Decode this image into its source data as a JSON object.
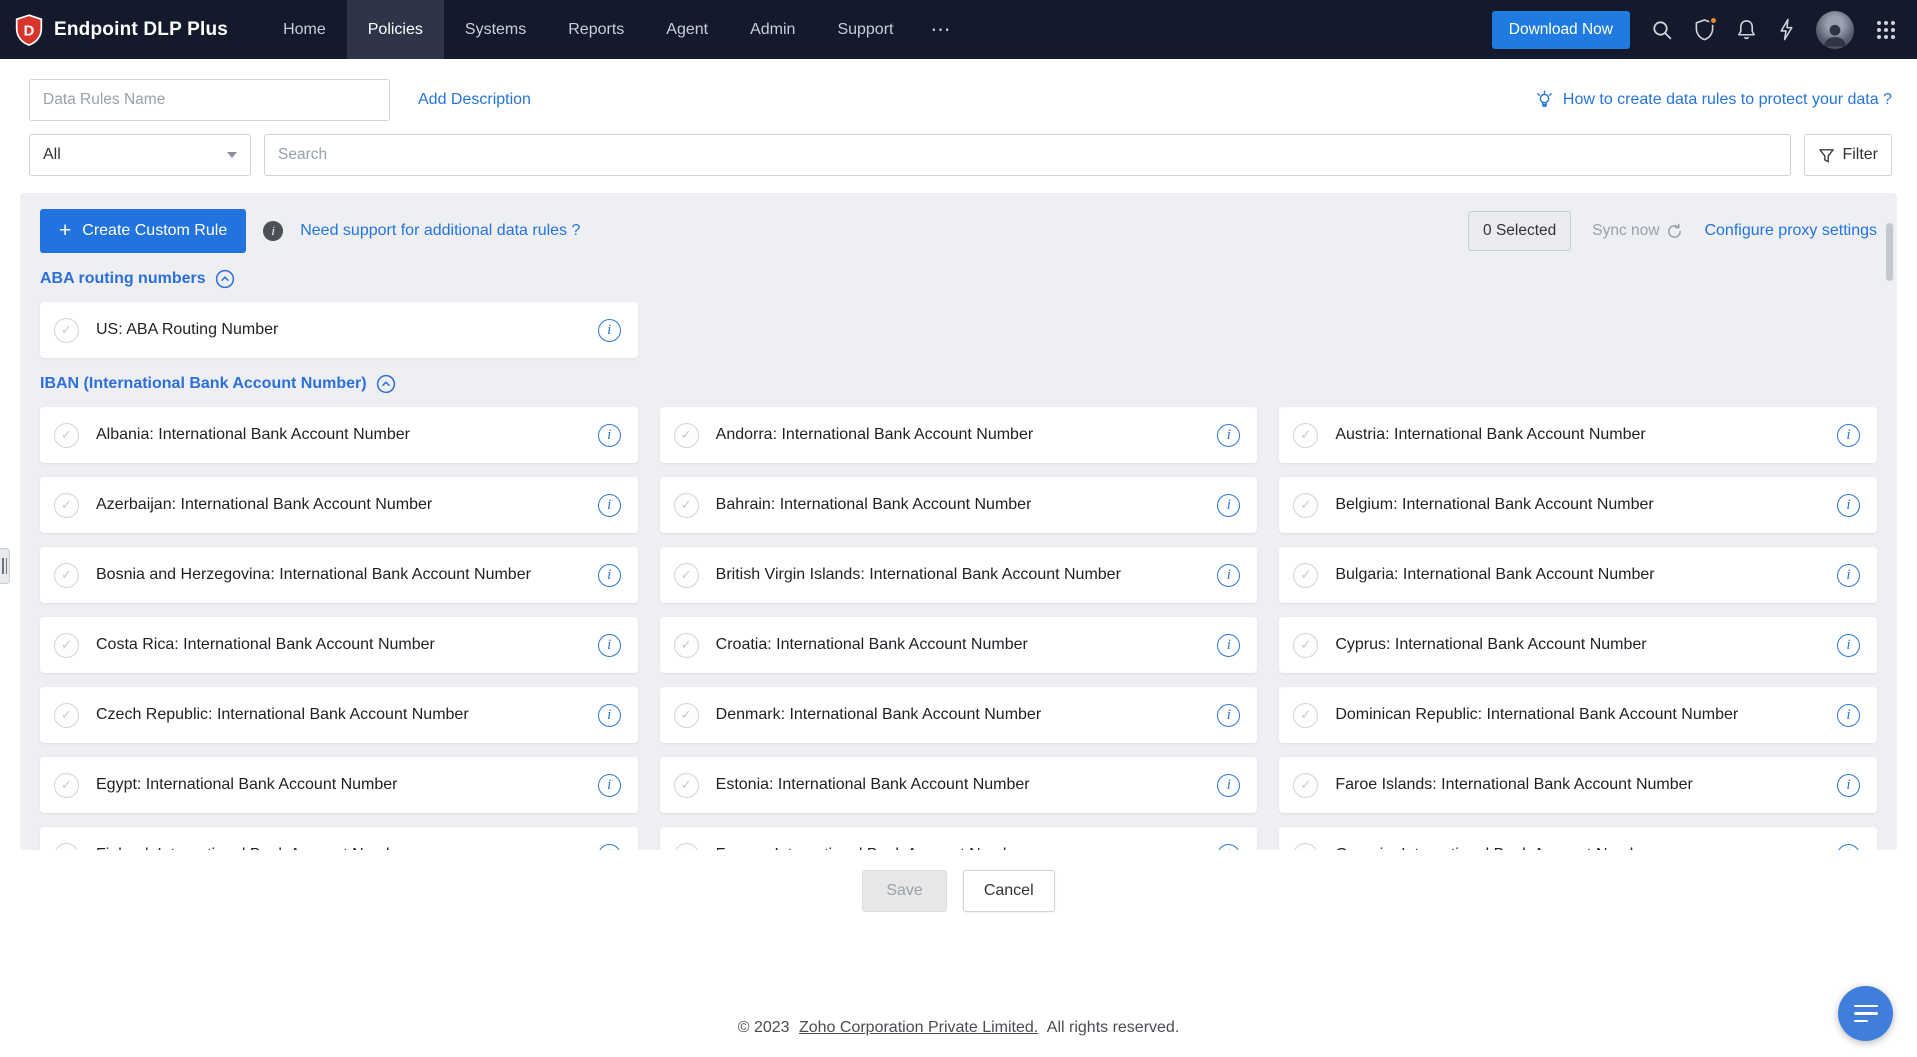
{
  "colors": {
    "navbar_bg": "#131a2c",
    "accent_blue": "#2273dd",
    "link_blue": "#2574dc",
    "panel_bg": "#edeff3",
    "notification_orange": "#e98b2a"
  },
  "icons": {
    "plus": "+",
    "info": "i",
    "check": "✓",
    "more": "⋯"
  },
  "navbar": {
    "brand": "Endpoint DLP Plus",
    "items": [
      {
        "label": "Home",
        "active": false
      },
      {
        "label": "Policies",
        "active": true
      },
      {
        "label": "Systems",
        "active": false
      },
      {
        "label": "Reports",
        "active": false
      },
      {
        "label": "Agent",
        "active": false
      },
      {
        "label": "Admin",
        "active": false
      },
      {
        "label": "Support",
        "active": false
      }
    ],
    "more_label": "⋯",
    "download_button": "Download Now"
  },
  "toolbar": {
    "name_placeholder": "Data Rules Name",
    "add_description": "Add Description",
    "help_link": "How to create data rules to protect your data ?",
    "filter_value": "All",
    "search_placeholder": "Search",
    "filter_button": "Filter"
  },
  "panel": {
    "create_button": "Create Custom Rule",
    "support_link": "Need support for additional data rules ?",
    "selected_badge": "0 Selected",
    "sync_now": "Sync now",
    "configure_proxy": "Configure proxy settings",
    "sections": [
      {
        "title": "ABA routing numbers",
        "rules": [
          "US: ABA Routing Number"
        ]
      },
      {
        "title": "IBAN (International Bank Account Number)",
        "rules": [
          "Albania: International Bank Account Number",
          "Andorra: International Bank Account Number",
          "Austria: International Bank Account Number",
          "Azerbaijan: International Bank Account Number",
          "Bahrain: International Bank Account Number",
          "Belgium: International Bank Account Number",
          "Bosnia and Herzegovina: International Bank Account Number",
          "British Virgin Islands: International Bank Account Number",
          "Bulgaria: International Bank Account Number",
          "Costa Rica: International Bank Account Number",
          "Croatia: International Bank Account Number",
          "Cyprus: International Bank Account Number",
          "Czech Republic: International Bank Account Number",
          "Denmark: International Bank Account Number",
          "Dominican Republic: International Bank Account Number",
          "Egypt: International Bank Account Number",
          "Estonia: International Bank Account Number",
          "Faroe Islands: International Bank Account Number",
          "Finland: International Bank Account Number",
          "France: International Bank Account Number",
          "Georgia: International Bank Account Number"
        ]
      }
    ]
  },
  "actions": {
    "save": "Save",
    "cancel": "Cancel"
  },
  "footer": {
    "copyright": "© 2023",
    "company": "Zoho Corporation Private Limited.",
    "rights": "All rights reserved."
  }
}
